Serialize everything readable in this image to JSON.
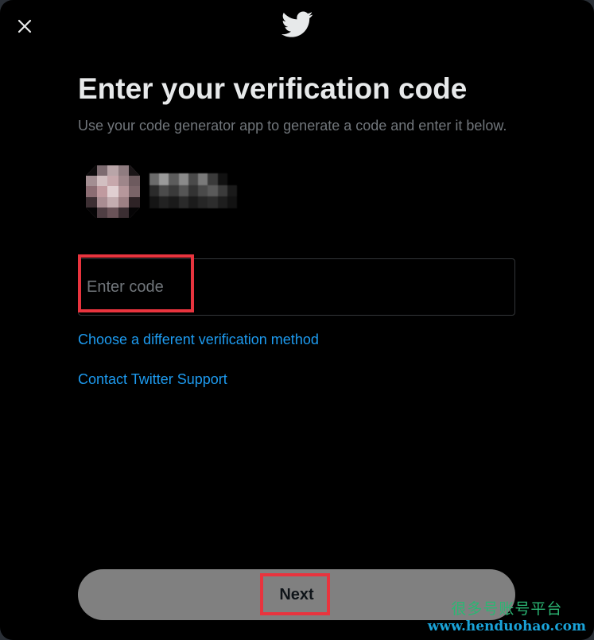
{
  "dialog": {
    "close_label": "×",
    "title": "Enter your verification code",
    "subtitle": "Use your code generator app to generate a code and enter it below."
  },
  "form": {
    "code_placeholder": "Enter code",
    "code_value": ""
  },
  "links": {
    "different_method": "Choose a different verification method",
    "support": "Contact Twitter Support"
  },
  "actions": {
    "next_label": "Next"
  },
  "watermark": {
    "text_cn": "很多号账号平台",
    "url": "www.henduohao.com"
  },
  "colors": {
    "background": "#000000",
    "title": "#e7e9ea",
    "muted": "#71767b",
    "link": "#1d9bf0",
    "button_disabled": "#808080",
    "highlight": "#e8343e"
  },
  "icons": {
    "close": "close-icon",
    "logo": "twitter-bird-icon"
  }
}
